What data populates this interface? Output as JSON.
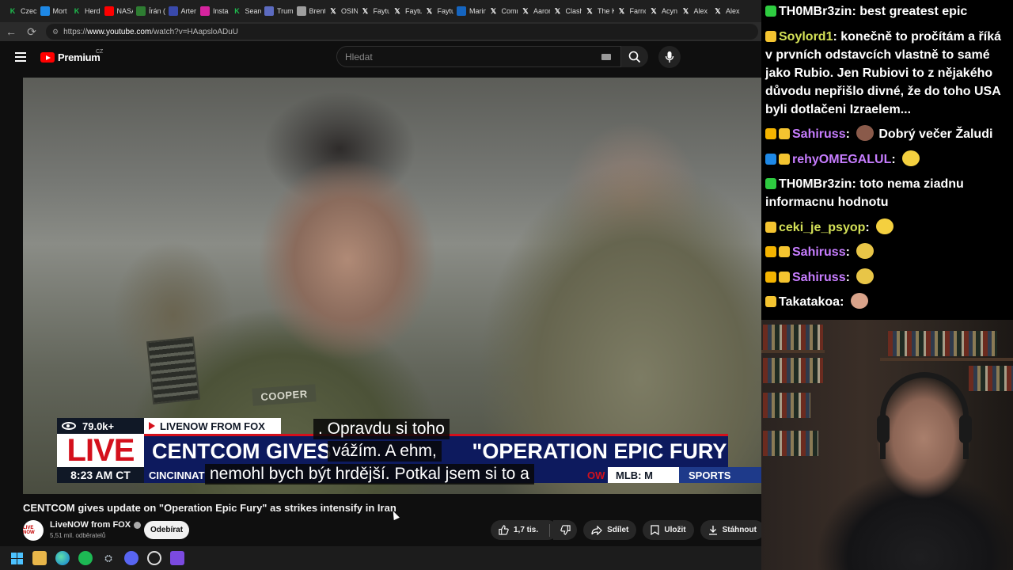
{
  "browser": {
    "tabs": [
      {
        "label": "Czech",
        "icon": "k-icon",
        "color": "#1fbf4f"
      },
      {
        "label": "Mort",
        "icon": "box-icon",
        "color": "#1e88e5"
      },
      {
        "label": "Herd",
        "icon": "k-icon",
        "color": "#1fbf4f"
      },
      {
        "label": "NASA",
        "icon": "youtube-icon",
        "color": "#ff0000"
      },
      {
        "label": "Írán (",
        "icon": "leaf-icon",
        "color": "#2e7d32"
      },
      {
        "label": "Arter",
        "icon": "circle-icon",
        "color": "#3949ab"
      },
      {
        "label": "Insta",
        "icon": "instagram-icon",
        "color": "#d6249f"
      },
      {
        "label": "Searc",
        "icon": "k-icon",
        "color": "#1fbf4f"
      },
      {
        "label": "Trum",
        "icon": "tv-icon",
        "color": "#5c6bc0"
      },
      {
        "label": "Brent",
        "icon": "globe-icon",
        "color": "#9e9e9e"
      },
      {
        "label": "OSIN",
        "icon": "x-icon",
        "color": "#000000"
      },
      {
        "label": "Faytu",
        "icon": "x-icon",
        "color": "#000000"
      },
      {
        "label": "Faytu",
        "icon": "x-icon",
        "color": "#000000"
      },
      {
        "label": "Faytu",
        "icon": "x-icon",
        "color": "#000000"
      },
      {
        "label": "Marin",
        "icon": "shield-icon",
        "color": "#1565c0"
      },
      {
        "label": "Comn",
        "icon": "x-icon",
        "color": "#000000"
      },
      {
        "label": "Aaror",
        "icon": "x-icon",
        "color": "#000000"
      },
      {
        "label": "Clash",
        "icon": "x-icon",
        "color": "#000000"
      },
      {
        "label": "The K",
        "icon": "x-icon",
        "color": "#000000"
      },
      {
        "label": "Farnc",
        "icon": "x-icon",
        "color": "#000000"
      },
      {
        "label": "Acyn",
        "icon": "x-icon",
        "color": "#000000"
      },
      {
        "label": "Alex",
        "icon": "x-icon",
        "color": "#000000"
      },
      {
        "label": "Alex",
        "icon": "x-icon",
        "color": "#000000"
      }
    ],
    "url_prefix": "https://",
    "url_domain": "www.youtube.com",
    "url_path": "/watch?v=HAapsloADuU"
  },
  "youtube": {
    "logo_text": "Premium",
    "country_code": "CZ",
    "search_placeholder": "Hledat",
    "video": {
      "live_views": "79.0k+",
      "source": "LIVENOW FROM FOX",
      "live_label": "LIVE",
      "time": "8:23 AM CT",
      "headline_left": "CENTCOM GIVES",
      "headline_right": "\"OPERATION EPIC FURY\"",
      "ticker_left": "CINCINNAT",
      "ticker_now": "OW",
      "ticker_mlb": "MLB:  M",
      "ticker_sports": "SPORTS",
      "nametape": "COOPER",
      "captions": [
        ".  Opravdu si toho",
        "vážím.  A ehm,",
        "nemohl bych být hrdější.   Potkal jsem si to a"
      ]
    },
    "title": "CENTCOM gives update on \"Operation Epic Fury\" as strikes intensify in Iran",
    "channel": {
      "name": "LiveNOW from FOX",
      "subs": "5,51 mil. odběratelů",
      "avatar_text": "LIVE NOW"
    },
    "subscribe_label": "Odebírat",
    "likes": "1,7 tis.",
    "share_label": "Sdílet",
    "save_label": "Uložit",
    "download_label": "Stáhnout"
  },
  "chat": [
    {
      "user": "TH0MBr3zin",
      "text": "best greatest epic",
      "user_color": "#ffffff",
      "badges": [
        "#2ecc40"
      ],
      "emote": null
    },
    {
      "user": "Soylord1",
      "text": "konečně to pročítám a říká v prvních odstavcích vlastně to samé jako Rubio. Jen Rubiovi to z nějakého důvodu nepřišlo divné, že do toho USA byli dotlačeni Izraelem...",
      "user_color": "#d4e157",
      "badges": [
        "#f4c430"
      ],
      "emote": null
    },
    {
      "user": "Sahiruss",
      "text": "Dobrý večer Žaludi",
      "user_color": "#c77dff",
      "badges": [
        "#f4b400",
        "#f4c430"
      ],
      "emote": "#8a5a4a"
    },
    {
      "user": "rehyOMEGALUL",
      "text": "",
      "user_color": "#c77dff",
      "badges": [
        "#1e88e5",
        "#f4c430"
      ],
      "emote": "#f4d03f"
    },
    {
      "user": "TH0MBr3zin",
      "text": "toto nema ziadnu informacnu hodnotu",
      "user_color": "#ffffff",
      "badges": [
        "#2ecc40"
      ],
      "emote": null
    },
    {
      "user": "ceki_je_psyop",
      "text": "",
      "user_color": "#d4e157",
      "badges": [
        "#f4c430"
      ],
      "emote": "#f4d03f"
    },
    {
      "user": "Sahiruss",
      "text": "",
      "user_color": "#c77dff",
      "badges": [
        "#f4b400",
        "#f4c430"
      ],
      "emote": "#e8c547"
    },
    {
      "user": "Sahiruss",
      "text": "",
      "user_color": "#c77dff",
      "badges": [
        "#f4b400",
        "#f4c430"
      ],
      "emote": "#e8c547"
    },
    {
      "user": "Takatakoa",
      "text": "",
      "user_color": "#ffffff",
      "badges": [
        "#f4c430"
      ],
      "emote": "#d9a38a"
    }
  ]
}
